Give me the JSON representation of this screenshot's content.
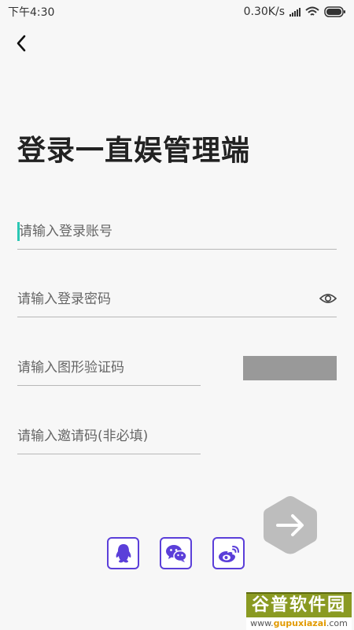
{
  "status_bar": {
    "time": "下午4:30",
    "network_speed": "0.30K/s"
  },
  "header": {
    "back_icon": "chevron-left-icon",
    "title": "登录一直娱管理端"
  },
  "form": {
    "account_placeholder": "请输入登录账号",
    "password_placeholder": "请输入登录密码",
    "captcha_placeholder": "请输入图形验证码",
    "invite_placeholder": "请输入邀请码(非必填)"
  },
  "social": {
    "items": [
      "qq-icon",
      "wechat-icon",
      "weibo-icon"
    ],
    "accent_color": "#5b3fd9"
  },
  "submit": {
    "icon": "arrow-right-icon",
    "color": "#bdbdbd"
  },
  "watermark": {
    "brand": "谷普软件园",
    "site_prefix": "www.",
    "site_domain": "gupuxiazai",
    "site_suffix": ".com"
  },
  "colors": {
    "background": "#f7f7f7",
    "cursor": "#2bc7b4"
  }
}
